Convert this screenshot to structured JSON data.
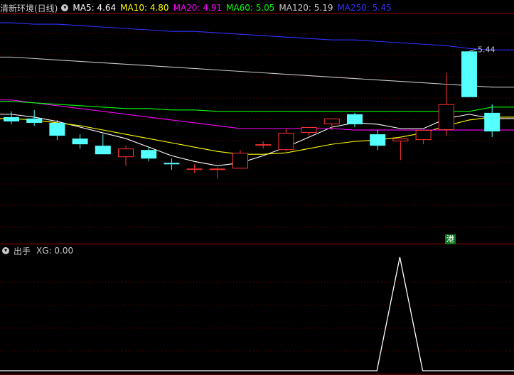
{
  "header": {
    "title": "清新环境(日线)",
    "ma": [
      {
        "label": "MA5: 4.64",
        "color": "#ffffff"
      },
      {
        "label": "MA10: 4.80",
        "color": "#ffff00"
      },
      {
        "label": "MA20: 4.91",
        "color": "#ff00ff"
      },
      {
        "label": "MA60: 5.05",
        "color": "#00ff00"
      },
      {
        "label": "MA120: 5.19",
        "color": "#c8c8c8"
      },
      {
        "label": "MA250: 5.45",
        "color": "#3030ff"
      }
    ]
  },
  "indicator": {
    "title": "出手",
    "value_label": "XG: 0.00"
  },
  "badge": "港",
  "chart_data": [
    {
      "type": "candlestick",
      "title": "清新环境(日线)",
      "price_range": [
        4.1,
        5.7
      ],
      "up_color": "#ff3232",
      "down_color": "#54ffff",
      "annotation": {
        "text": "5.44",
        "candle_index": 20
      },
      "candles": [
        {
          "o": 4.98,
          "h": 5.02,
          "l": 4.93,
          "c": 4.95
        },
        {
          "o": 4.97,
          "h": 5.03,
          "l": 4.92,
          "c": 4.94
        },
        {
          "o": 4.94,
          "h": 4.96,
          "l": 4.82,
          "c": 4.85
        },
        {
          "o": 4.83,
          "h": 4.86,
          "l": 4.76,
          "c": 4.79
        },
        {
          "o": 4.78,
          "h": 4.86,
          "l": 4.72,
          "c": 4.72
        },
        {
          "o": 4.7,
          "h": 4.78,
          "l": 4.64,
          "c": 4.76
        },
        {
          "o": 4.75,
          "h": 4.77,
          "l": 4.67,
          "c": 4.69
        },
        {
          "o": 4.66,
          "h": 4.69,
          "l": 4.61,
          "c": 4.65
        },
        {
          "o": 4.62,
          "h": 4.65,
          "l": 4.59,
          "c": 4.62
        },
        {
          "o": 4.61,
          "h": 4.63,
          "l": 4.55,
          "c": 4.62
        },
        {
          "o": 4.62,
          "h": 4.75,
          "l": 4.62,
          "c": 4.73
        },
        {
          "o": 4.79,
          "h": 4.81,
          "l": 4.76,
          "c": 4.79
        },
        {
          "o": 4.75,
          "h": 4.9,
          "l": 4.74,
          "c": 4.87
        },
        {
          "o": 4.87,
          "h": 4.91,
          "l": 4.85,
          "c": 4.91
        },
        {
          "o": 4.93,
          "h": 4.97,
          "l": 4.89,
          "c": 4.97
        },
        {
          "o": 5.0,
          "h": 5.01,
          "l": 4.91,
          "c": 4.93
        },
        {
          "o": 4.86,
          "h": 4.89,
          "l": 4.75,
          "c": 4.78
        },
        {
          "o": 4.81,
          "h": 4.83,
          "l": 4.68,
          "c": 4.83
        },
        {
          "o": 4.82,
          "h": 4.89,
          "l": 4.79,
          "c": 4.89
        },
        {
          "o": 4.89,
          "h": 5.29,
          "l": 4.85,
          "c": 5.07
        },
        {
          "o": 5.44,
          "h": 5.44,
          "l": 5.12,
          "c": 5.12
        },
        {
          "o": 5.01,
          "h": 5.07,
          "l": 4.84,
          "c": 4.88
        }
      ],
      "ma_series": [
        {
          "name": "MA5",
          "color": "#ffffff",
          "values": [
            5.0,
            4.98,
            4.95,
            4.91,
            4.87,
            4.83,
            4.77,
            4.71,
            4.67,
            4.64,
            4.66,
            4.71,
            4.77,
            4.84,
            4.91,
            4.94,
            4.93,
            4.9,
            4.9,
            4.97,
            5.0,
            4.97
          ]
        },
        {
          "name": "MA10",
          "color": "#ffff00",
          "values": [
            4.97,
            4.96,
            4.94,
            4.92,
            4.89,
            4.86,
            4.83,
            4.8,
            4.77,
            4.74,
            4.72,
            4.72,
            4.73,
            4.76,
            4.79,
            4.81,
            4.82,
            4.84,
            4.87,
            4.92,
            4.96,
            4.98
          ]
        },
        {
          "name": "MA20",
          "color": "#ff00ff",
          "values": [
            5.1,
            5.08,
            5.06,
            5.04,
            5.02,
            5.0,
            4.98,
            4.96,
            4.94,
            4.92,
            4.9,
            4.9,
            4.9,
            4.9,
            4.9,
            4.89,
            4.89,
            4.89,
            4.89,
            4.89,
            4.89,
            4.89
          ]
        },
        {
          "name": "MA60",
          "color": "#00ff00",
          "values": [
            5.09,
            5.08,
            5.07,
            5.06,
            5.05,
            5.04,
            5.04,
            5.03,
            5.03,
            5.02,
            5.02,
            5.02,
            5.02,
            5.02,
            5.02,
            5.02,
            5.02,
            5.02,
            5.02,
            5.02,
            5.02,
            5.05
          ]
        },
        {
          "name": "MA120",
          "color": "#c8c8c8",
          "values": [
            5.4,
            5.39,
            5.38,
            5.37,
            5.36,
            5.35,
            5.34,
            5.33,
            5.32,
            5.31,
            5.3,
            5.29,
            5.28,
            5.27,
            5.26,
            5.25,
            5.24,
            5.23,
            5.22,
            5.21,
            5.2,
            5.19
          ]
        },
        {
          "name": "MA250",
          "color": "#3030ff",
          "values": [
            5.64,
            5.63,
            5.63,
            5.62,
            5.61,
            5.6,
            5.59,
            5.58,
            5.58,
            5.57,
            5.56,
            5.55,
            5.54,
            5.53,
            5.52,
            5.52,
            5.51,
            5.5,
            5.49,
            5.48,
            5.46,
            5.45
          ]
        }
      ]
    },
    {
      "type": "line",
      "title": "出手",
      "y_range": [
        0,
        1
      ],
      "series": [
        {
          "name": "XG",
          "color": "#ffffff",
          "values": [
            0,
            0,
            0,
            0,
            0,
            0,
            0,
            0,
            0,
            0,
            0,
            0,
            0,
            0,
            0,
            0,
            0,
            1,
            0,
            0,
            0,
            0
          ]
        }
      ]
    }
  ]
}
